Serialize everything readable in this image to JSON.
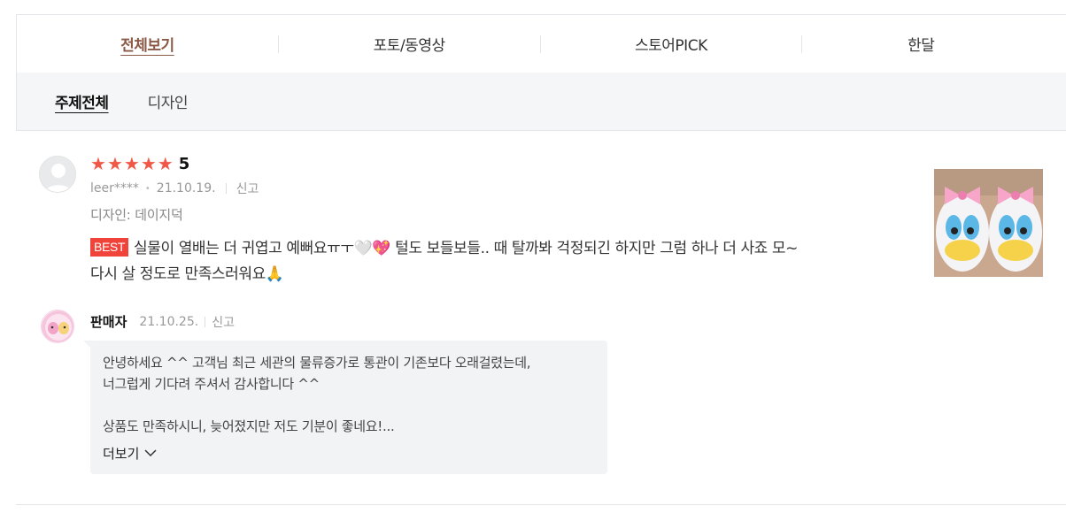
{
  "tabs": [
    {
      "label": "전체보기",
      "active": true
    },
    {
      "label": "포토/동영상",
      "active": false
    },
    {
      "label": "스토어PICK",
      "active": false
    },
    {
      "label": "한달",
      "active": false
    }
  ],
  "subtabs": [
    {
      "label": "주제전체",
      "active": true
    },
    {
      "label": "디자인",
      "active": false
    }
  ],
  "review": {
    "rating": 5,
    "score_label": "5",
    "user": "leer****",
    "date": "21.10.19.",
    "report": "신고",
    "option": "디자인: 데이지덕",
    "badge": "BEST",
    "text_line1": "실물이 열배는 더 귀엽고 예뻐요ㅠㅜ🤍💖 털도 보들보들.. 때 탈까봐 걱정되긴 하지만 그럼 하나 더 사죠 모~",
    "text_line2": "다시 살 정도로 만족스러워요🙏"
  },
  "seller": {
    "name": "판매자",
    "date": "21.10.25.",
    "report": "신고",
    "reply_line1": "안녕하세요 ^^ 고객님 최근 세관의 물류증가로 통관이 기존보다 오래걸렸는데,",
    "reply_line2": "너그럽게 기다려 주셔서 감사합니다 ^^",
    "reply_line3": "상품도 만족하시니, 늦어졌지만 저도 기분이 좋네요!...",
    "more_label": "더보기"
  },
  "colors": {
    "accent_tab": "#8b5a46",
    "star": "#f15746",
    "best_badge": "#f0443a",
    "reply_bg": "#f2f3f5"
  }
}
